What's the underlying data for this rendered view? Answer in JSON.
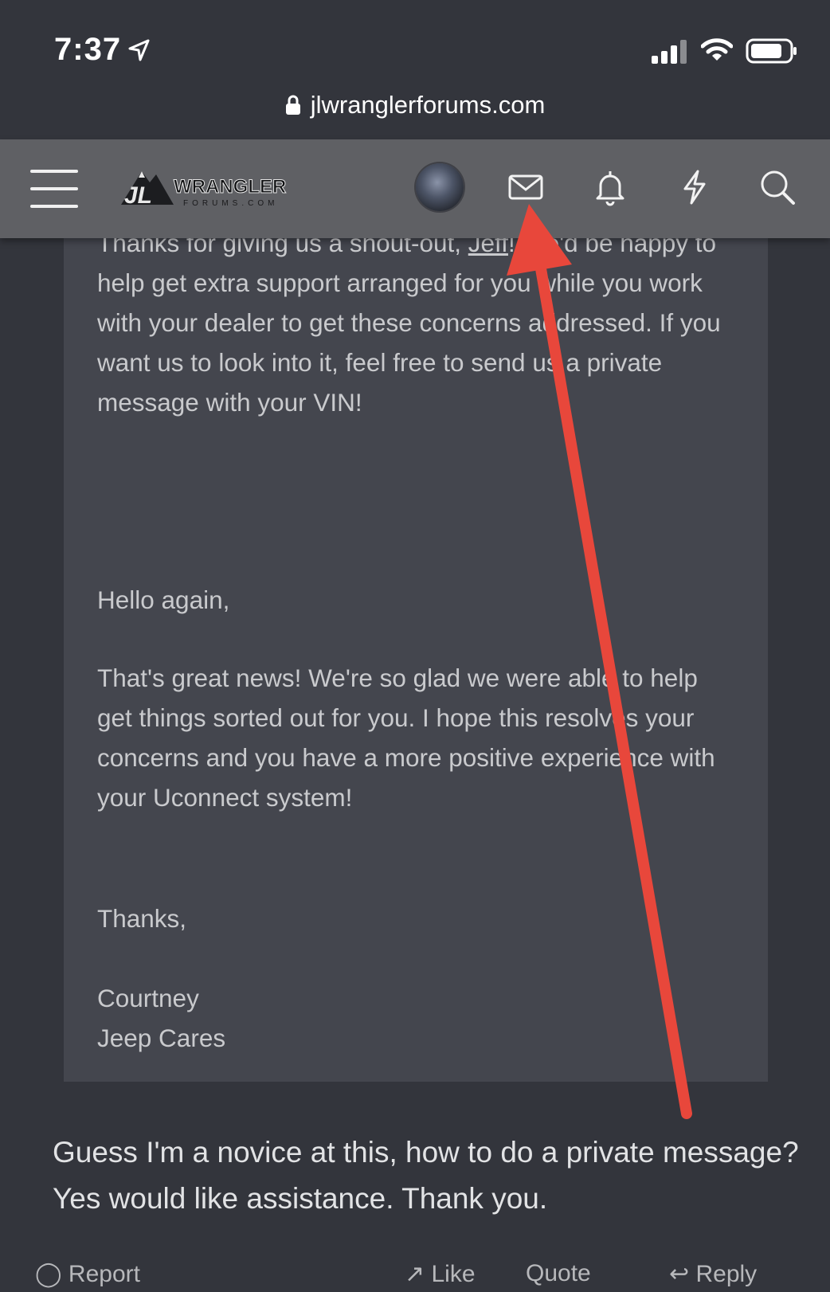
{
  "status_bar": {
    "time": "7:37",
    "icons": [
      "location-arrow-icon",
      "cellular-signal-icon",
      "wifi-icon",
      "battery-icon"
    ]
  },
  "browser": {
    "url": "jlwranglerforums.com"
  },
  "header": {
    "logo_text_main": "WRANGLER",
    "logo_text_sub": "FORUMS.COM",
    "logo_mark": "JL",
    "icons": [
      "menu-icon",
      "avatar",
      "mail-icon",
      "bell-icon",
      "bolt-icon",
      "search-icon"
    ]
  },
  "quote": {
    "para1_start": "Thanks for giving us a shout-out, ",
    "para1_link": "Jeff",
    "para1_rest": "! We'd be happy to help get extra support arranged for you while you work with your dealer to get these concerns addressed. If you want us to look into it, feel free to send us a private message with your VIN!",
    "greeting": "Hello again,",
    "body": "That's great news! We're so glad we were able to help get things sorted out for you. I hope this resolves your concerns and you have a more positive experience with your Uconnect system!",
    "thanks": "Thanks,",
    "name": "Courtney",
    "org": "Jeep Cares"
  },
  "reply": {
    "text": "Guess I'm a novice at this, how to do a private message? Yes would like assistance. Thank you."
  },
  "actions": {
    "report": "Report",
    "like": "Like",
    "quote": "Quote",
    "reply": "Reply"
  },
  "colors": {
    "page_bg": "#33353c",
    "header_bg": "#5f6064",
    "quote_bg": "#44464e",
    "arrow": "#e8473b"
  }
}
